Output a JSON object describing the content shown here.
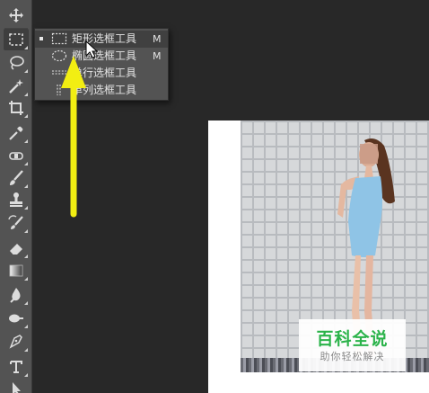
{
  "toolbar": {
    "tools": [
      {
        "name": "move-tool",
        "icon": "move-icon"
      },
      {
        "name": "rectangular-marquee-tool",
        "icon": "marquee-icon",
        "active": true
      },
      {
        "name": "lasso-tool",
        "icon": "lasso-icon"
      },
      {
        "name": "magic-wand-tool",
        "icon": "magic-wand-icon"
      },
      {
        "name": "crop-tool",
        "icon": "crop-icon"
      },
      {
        "name": "eyedropper-tool",
        "icon": "eyedropper-icon"
      },
      {
        "name": "healing-brush-tool",
        "icon": "bandage-icon"
      },
      {
        "name": "brush-tool",
        "icon": "brush-icon"
      },
      {
        "name": "clone-stamp-tool",
        "icon": "stamp-icon"
      },
      {
        "name": "history-brush-tool",
        "icon": "history-brush-icon"
      },
      {
        "name": "eraser-tool",
        "icon": "eraser-icon"
      },
      {
        "name": "gradient-tool",
        "icon": "gradient-icon"
      },
      {
        "name": "blur-tool",
        "icon": "blur-icon"
      },
      {
        "name": "dodge-tool",
        "icon": "dodge-icon"
      },
      {
        "name": "pen-tool",
        "icon": "pen-icon"
      },
      {
        "name": "type-tool",
        "icon": "type-icon"
      },
      {
        "name": "path-selection-tool",
        "icon": "arrow-cursor-icon"
      }
    ]
  },
  "flyout": {
    "items": [
      {
        "label": "矩形选框工具",
        "shortcut": "M",
        "icon": "rect-marquee-icon",
        "selected": true
      },
      {
        "label": "椭圆选框工具",
        "shortcut": "M",
        "icon": "ellipse-marquee-icon",
        "selected": false
      },
      {
        "label": "单行选框工具",
        "shortcut": "",
        "icon": "single-row-marquee-icon",
        "selected": false
      },
      {
        "label": "单列选框工具",
        "shortcut": "",
        "icon": "single-column-marquee-icon",
        "selected": false
      }
    ]
  },
  "watermark": {
    "title": "百科全说",
    "subtitle": "助你轻松解决"
  },
  "colors": {
    "workspace": "#282828",
    "toolbar": "#535353",
    "arrow": "#f2ee12",
    "watermark_green": "#2bb34a"
  }
}
